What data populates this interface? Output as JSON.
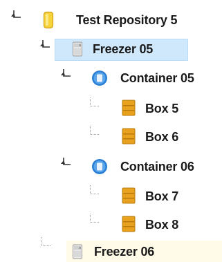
{
  "tree": {
    "repository": {
      "label": "Test Repository 5",
      "icon": "repository-icon",
      "color": "#f7d23a"
    },
    "freezer_05": {
      "label": "Freezer 05",
      "icon": "freezer-icon",
      "selected": true
    },
    "container_05": {
      "label": "Container 05",
      "icon": "container-icon",
      "color": "#2a7fd4"
    },
    "box_5": {
      "label": "Box 5",
      "icon": "box-icon",
      "color": "#e8a21f"
    },
    "box_6": {
      "label": "Box 6",
      "icon": "box-icon",
      "color": "#e8a21f"
    },
    "container_06": {
      "label": "Container 06",
      "icon": "container-icon",
      "color": "#2a7fd4"
    },
    "box_7": {
      "label": "Box 7",
      "icon": "box-icon",
      "color": "#e8a21f"
    },
    "box_8": {
      "label": "Box 8",
      "icon": "box-icon",
      "color": "#e8a21f"
    },
    "freezer_06": {
      "label": "Freezer 06",
      "icon": "freezer-icon"
    }
  },
  "colors": {
    "selection_bg": "#cfe8fb",
    "footer_highlight": "#fffbe8"
  }
}
